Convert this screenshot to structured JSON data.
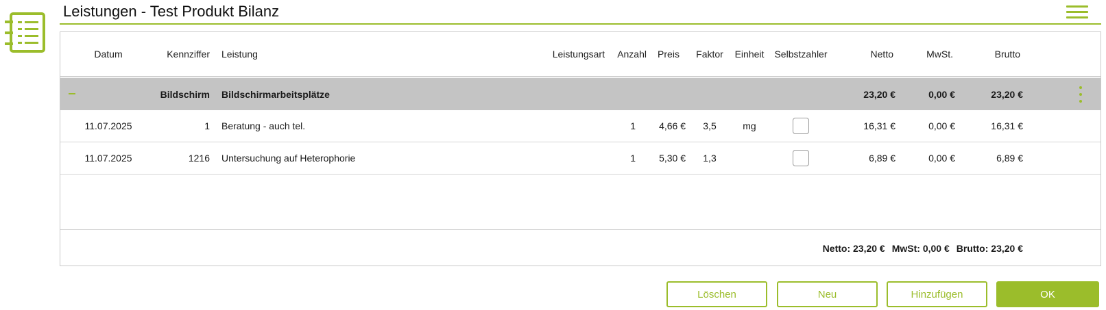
{
  "header": {
    "title": "Leistungen - Test Produkt Bilanz"
  },
  "icons": {
    "app": "list-document-icon",
    "menu": "hamburger-menu-icon"
  },
  "colors": {
    "accent": "#9bbd2b",
    "group_bg": "#c4c4c4"
  },
  "table": {
    "columns": {
      "datum": "Datum",
      "kennziffer": "Kennziffer",
      "leistung": "Leistung",
      "leistungsart": "Leistungsart",
      "anzahl": "Anzahl",
      "preis": "Preis",
      "faktor": "Faktor",
      "einheit": "Einheit",
      "selbstzahler": "Selbstzahler",
      "netto": "Netto",
      "mwst": "MwSt.",
      "brutto": "Brutto"
    },
    "group": {
      "kennziffer": "Bildschirm",
      "leistung": "Bildschirmarbeitsplätze",
      "netto": "23,20 €",
      "mwst": "0,00 €",
      "brutto": "23,20 €"
    },
    "rows": [
      {
        "datum": "11.07.2025",
        "kennziffer": "1",
        "leistung": "Beratung - auch tel.",
        "leistungsart": "",
        "anzahl": "1",
        "preis": "4,66 €",
        "faktor": "3,5",
        "einheit": "mg",
        "selbstzahler": false,
        "netto": "16,31 €",
        "mwst": "0,00 €",
        "brutto": "16,31 €"
      },
      {
        "datum": "11.07.2025",
        "kennziffer": "1216",
        "leistung": "Untersuchung auf Heterophorie",
        "leistungsart": "",
        "anzahl": "1",
        "preis": "5,30 €",
        "faktor": "1,3",
        "einheit": "",
        "selbstzahler": false,
        "netto": "6,89 €",
        "mwst": "0,00 €",
        "brutto": "6,89 €"
      }
    ],
    "totals": {
      "netto": "Netto: 23,20 €",
      "mwst": "MwSt: 0,00 €",
      "brutto": "Brutto: 23,20 €"
    }
  },
  "buttons": {
    "delete": "Löschen",
    "new": "Neu",
    "add": "Hinzufügen",
    "ok": "OK"
  }
}
